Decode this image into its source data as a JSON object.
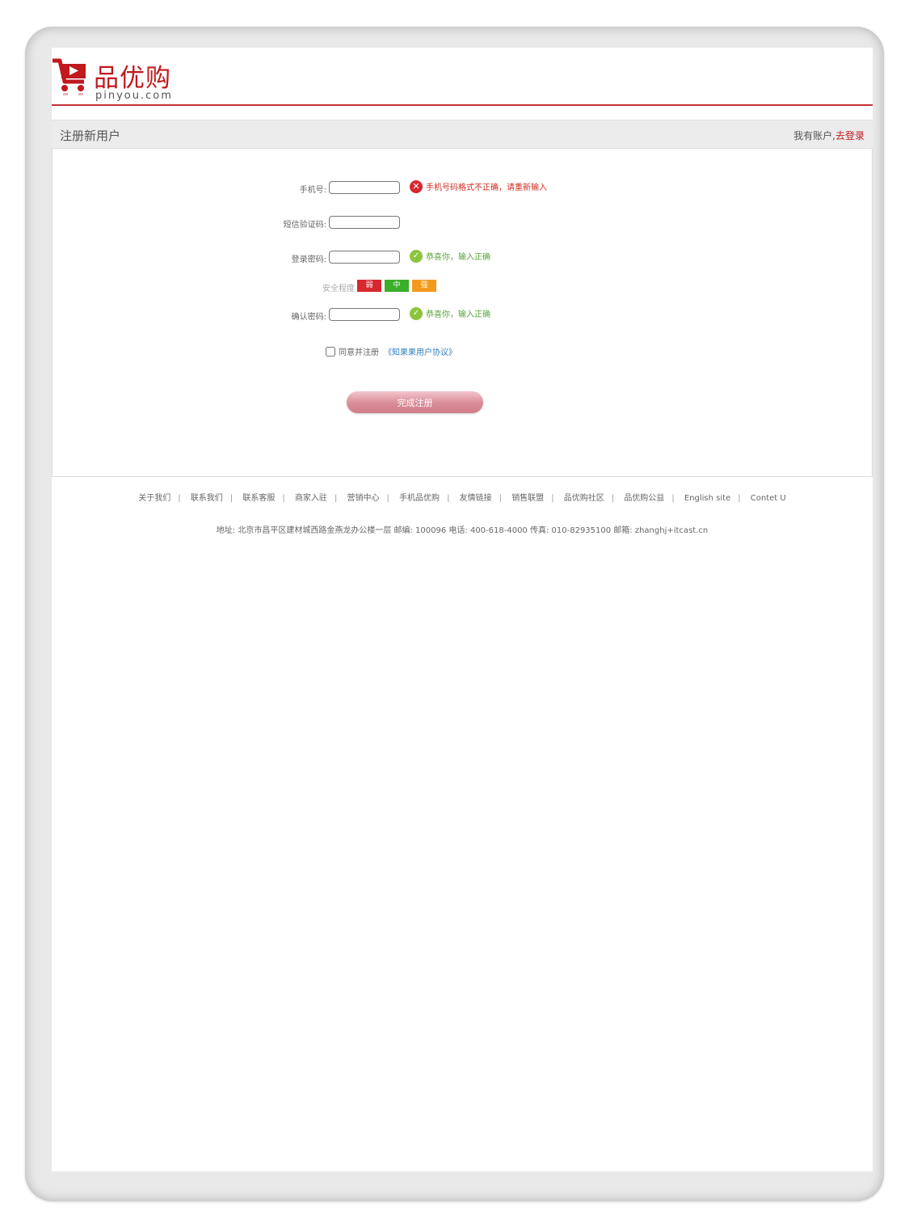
{
  "header": {
    "logo_title": "品优购",
    "logo_sub": "pinyou.com",
    "brand_color": "#c0191e"
  },
  "titlebar": {
    "title": "注册新用户",
    "have_account": "我有账户,",
    "login_link": "去登录"
  },
  "form": {
    "phone_label": "手机号:",
    "phone_error": "手机号码格式不正确，请重新输入",
    "sms_label": "短信验证码:",
    "password_label": "登录密码:",
    "password_ok": "恭喜你，输入正确",
    "strength_label": "安全程度",
    "strength_weak": "弱",
    "strength_mid": "中",
    "strength_strong": "强",
    "confirm_label": "确认密码:",
    "confirm_ok": "恭喜你，输入正确",
    "agree_text": "同意并注册",
    "agreement_link": "《知果果用户协议》",
    "submit_label": "完成注册"
  },
  "footer": {
    "links": [
      "关于我们",
      "联系我们",
      "联系客服",
      "商家入驻",
      "营销中心",
      "手机品优购",
      "友情链接",
      "销售联盟",
      "品优购社区",
      "品优购公益",
      "English site",
      "Contet U"
    ],
    "address": "地址: 北京市昌平区建材城西路金燕龙办公楼一层 邮编: 100096 电话: 400-618-4000 传真: 010-82935100 邮箱: zhanghj+itcast.cn"
  },
  "colors": {
    "error": "#d02b20",
    "ok": "#5aa53a",
    "weak": "#d7282f",
    "mid": "#3bae2b",
    "strong": "#f39a1e"
  }
}
